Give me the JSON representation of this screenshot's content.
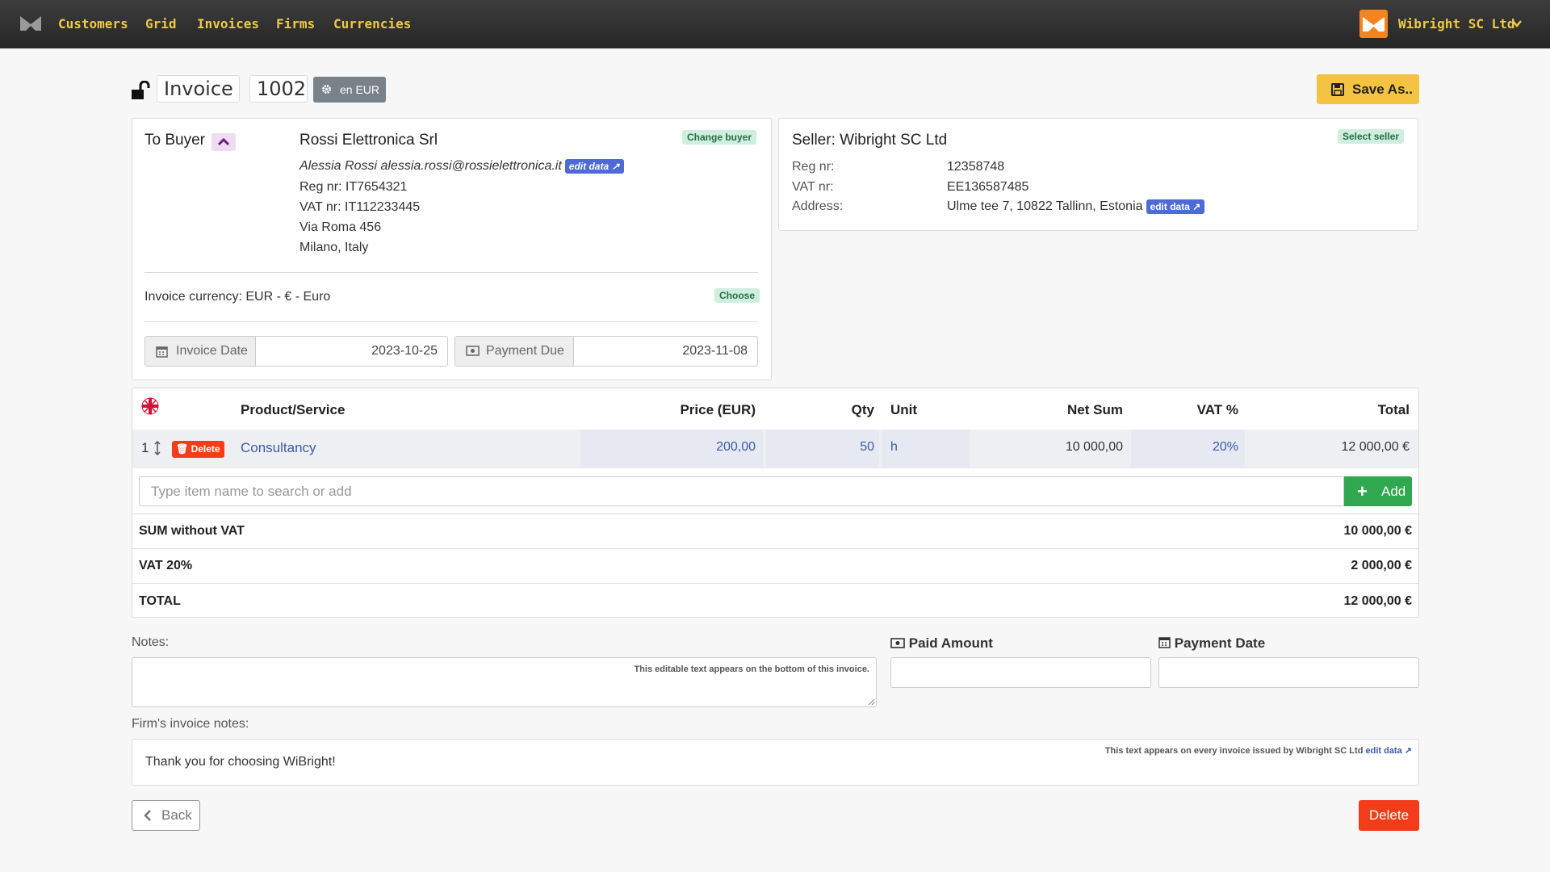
{
  "nav": {
    "links": [
      "Customers",
      "Grid",
      "Invoices",
      "Firms",
      "Currencies"
    ],
    "user": "Wibright SC Ltd"
  },
  "invoice": {
    "title": "Invoice",
    "number": "1002",
    "lang_badge": "en EUR",
    "save_label": "Save As.."
  },
  "buyer": {
    "heading": "To Buyer",
    "change_label": "Change buyer",
    "name": "Rossi Elettronica Srl",
    "contact": "Alessia Rossi alessia.rossi@rossielettronica.it",
    "edit_label": "edit data",
    "reg": "Reg nr: IT7654321",
    "vat": "VAT nr: IT112233445",
    "street": "Via Roma 456",
    "city": "Milano, Italy",
    "currency": "Invoice currency: EUR - € - Euro",
    "choose_label": "Choose",
    "invoice_date_label": "Invoice Date",
    "invoice_date": "2023-10-25",
    "payment_due_label": "Payment Due",
    "payment_due": "2023-11-08"
  },
  "seller": {
    "heading": "Seller: Wibright SC Ltd",
    "select_label": "Select seller",
    "reg_label": "Reg nr:",
    "reg": "12358748",
    "vat_label": "VAT nr:",
    "vat": "EE136587485",
    "address_label": "Address:",
    "address": "Ulme tee 7, 10822 Tallinn, Estonia",
    "edit_label": "edit data"
  },
  "table": {
    "headers": {
      "product": "Product/Service",
      "price": "Price  (EUR)",
      "qty": "Qty",
      "unit": "Unit",
      "net": "Net Sum",
      "vat": "VAT %",
      "total": "Total"
    },
    "rows": [
      {
        "num": "1",
        "delete": "Delete",
        "product": "Consultancy",
        "price": "200,00",
        "qty": "50",
        "unit": "h",
        "net": "10 000,00",
        "vat": "20%",
        "total": "12 000,00 €"
      }
    ],
    "search_placeholder": "Type item name to search or add",
    "add_label": "Add"
  },
  "summary": {
    "sum_label": "SUM without VAT",
    "sum_value": "10 000,00 €",
    "vat_label": "VAT 20%",
    "vat_value": "2 000,00 €",
    "total_label": "TOTAL",
    "total_value": "12 000,00 €"
  },
  "notes": {
    "label": "Notes:",
    "hint": "This editable text appears on the bottom of this invoice.",
    "paid_amount_label": "Paid Amount",
    "payment_date_label": "Payment Date",
    "firm_notes_label": "Firm's invoice notes:",
    "firm_notes_hint": "This text appears on every invoice issued by Wibright SC Ltd",
    "firm_notes_edit": "edit data",
    "firm_notes_text": "Thank you for choosing WiBright!"
  },
  "footer": {
    "back_label": "Back",
    "delete_label": "Delete"
  },
  "colors": {
    "navbar": "#2e2e2e",
    "nav_link": "#f0c948",
    "save": "#f5c342",
    "add": "#2fa84f",
    "delete": "#f33c1a",
    "link": "#3b5aa8"
  }
}
